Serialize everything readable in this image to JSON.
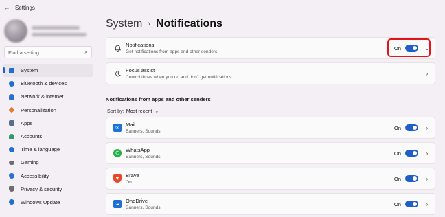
{
  "window": {
    "title": "Settings"
  },
  "sidebar": {
    "search_placeholder": "Find a setting",
    "items": [
      {
        "label": "System",
        "icon": "monitor-icon",
        "color": "#1f6fd1",
        "active": true
      },
      {
        "label": "Bluetooth & devices",
        "icon": "bluetooth-icon",
        "color": "#1f6fd1"
      },
      {
        "label": "Network & internet",
        "icon": "wifi-icon",
        "color": "#2b6fd6"
      },
      {
        "label": "Personalization",
        "icon": "brush-icon",
        "color": "#e07a2e"
      },
      {
        "label": "Apps",
        "icon": "apps-icon",
        "color": "#5a6e8a"
      },
      {
        "label": "Accounts",
        "icon": "person-icon",
        "color": "#2e9b6f"
      },
      {
        "label": "Time & language",
        "icon": "globe-clock-icon",
        "color": "#1f6fd1"
      },
      {
        "label": "Gaming",
        "icon": "gamepad-icon",
        "color": "#6d6d6d"
      },
      {
        "label": "Accessibility",
        "icon": "accessibility-icon",
        "color": "#2b6fd6"
      },
      {
        "label": "Privacy & security",
        "icon": "shield-icon",
        "color": "#6d6d6d"
      },
      {
        "label": "Windows Update",
        "icon": "update-icon",
        "color": "#1f6fd1"
      }
    ]
  },
  "breadcrumb": {
    "parent": "System",
    "current": "Notifications"
  },
  "notifications_card": {
    "title": "Notifications",
    "subtitle": "Get notifications from apps and other senders",
    "state": "On"
  },
  "focus_card": {
    "title": "Focus assist",
    "subtitle": "Control times when you do and don't get notifications"
  },
  "section_title": "Notifications from apps and other senders",
  "sort": {
    "label": "Sort by:",
    "value": "Most recent"
  },
  "apps": [
    {
      "name": "Mail",
      "detail": "Banners, Sounds",
      "state": "On",
      "icon": "mail-icon",
      "color": "#1a73d9"
    },
    {
      "name": "WhatsApp",
      "detail": "Banners, Sounds",
      "state": "On",
      "icon": "whatsapp-icon",
      "color": "#25b04a"
    },
    {
      "name": "Brave",
      "detail": "On",
      "state": "On",
      "icon": "brave-icon",
      "color": "#e8472a"
    },
    {
      "name": "OneDrive",
      "detail": "Banners, Sounds",
      "state": "On",
      "icon": "onedrive-icon",
      "color": "#1f6fd1"
    }
  ]
}
